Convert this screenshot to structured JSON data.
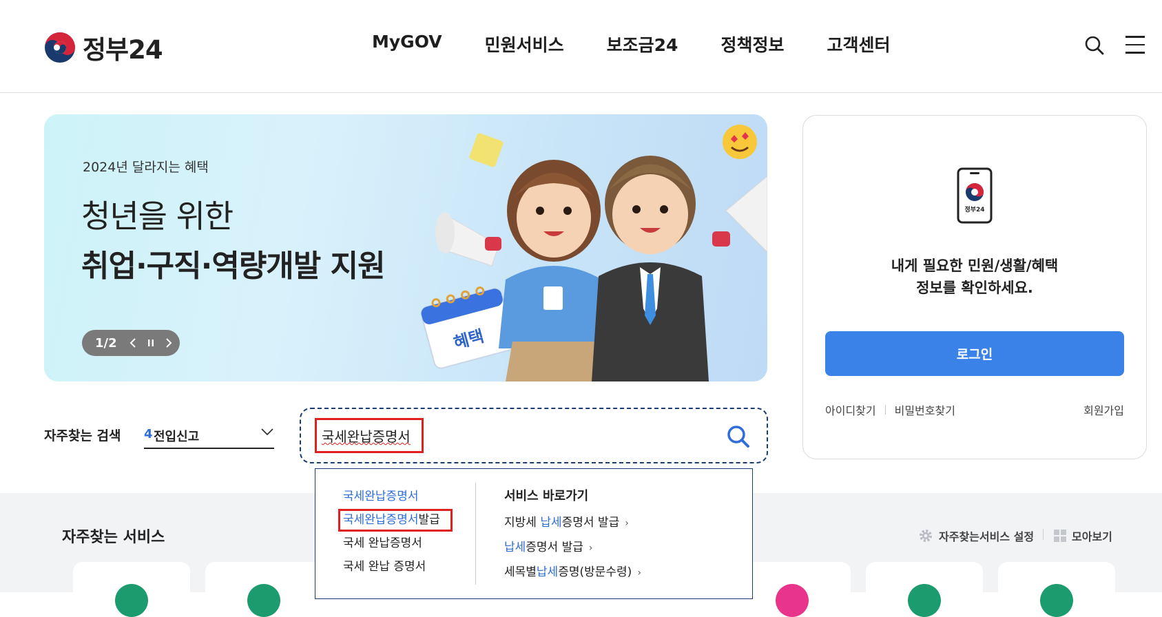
{
  "header": {
    "logo_text": "정부24",
    "nav": [
      "MyGOV",
      "민원서비스",
      "보조금24",
      "정책정보",
      "고객센터"
    ]
  },
  "banner": {
    "eyebrow": "2024년 달라지는 혜택",
    "title_line1": "청년을 위한",
    "title_line2": "취업·구직·역량개발 지원",
    "pager": "1/2",
    "calendar_label": "혜택"
  },
  "login": {
    "phone_label": "정부24",
    "message_line1": "내게 필요한 민원/생활/혜택",
    "message_line2": "정보를 확인하세요.",
    "button": "로그인",
    "find_id": "아이디찾기",
    "find_pw": "비밀번호찾기",
    "join": "회원가입"
  },
  "frequent_search": {
    "label": "자주찾는 검색",
    "rank": "4",
    "keyword": "전입신고"
  },
  "search": {
    "value": "국세완납증명서"
  },
  "autocomplete": {
    "suggestions": [
      {
        "hl": "국세완납증명서",
        "rest": ""
      },
      {
        "hl": "국세완납증명서",
        "rest": "발급"
      },
      {
        "hl": "",
        "rest": "국세 완납증명서"
      },
      {
        "hl": "",
        "rest": "국세 완납 증명서"
      }
    ],
    "shortcut_title": "서비스 바로가기",
    "shortcuts": [
      {
        "pre": "지방세 ",
        "hl": "납세",
        "post": "증명서 발급"
      },
      {
        "pre": "",
        "hl": "납세",
        "post": "증명서 발급"
      },
      {
        "pre": "세목별",
        "hl": "납세",
        "post": "증명(방문수령)"
      }
    ]
  },
  "services": {
    "title": "자주찾는 서비스",
    "settings": "자주찾는서비스 설정",
    "view_all": "모아보기"
  },
  "colors": {
    "accent": "#3b82e8",
    "highlight": "#2f6ddb",
    "annotation_red": "#e01f1f"
  }
}
